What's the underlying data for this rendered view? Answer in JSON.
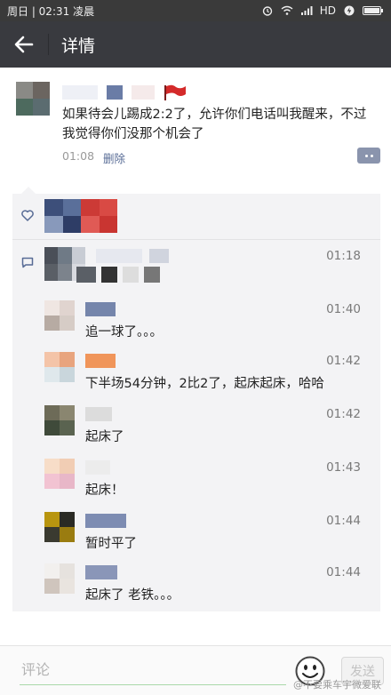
{
  "statusbar": {
    "left": "周日 | 02:31 凌晨",
    "network": "HD"
  },
  "header": {
    "title": "详情"
  },
  "post": {
    "text": "如果待会儿踢成2:2了，允许你们电话叫我醒来，不过我觉得你们没那个机会了",
    "time": "01:08",
    "delete_label": "删除"
  },
  "comments": [
    {
      "time": "01:18",
      "text": ""
    },
    {
      "time": "01:40",
      "text": "追一球了。。。"
    },
    {
      "time": "01:42",
      "text": "下半场54分钟，2比2了，起床起床，哈哈"
    },
    {
      "time": "01:42",
      "text": "起床了"
    },
    {
      "time": "01:43",
      "text": "起床！"
    },
    {
      "time": "01:44",
      "text": "暂时平了"
    },
    {
      "time": "01:44",
      "text": "起床了 老铁。。。"
    }
  ],
  "input": {
    "placeholder": "评论",
    "send_label": "发送"
  },
  "watermark": "@不要乘车宇微爱联",
  "icons": {
    "back": "back-arrow-icon",
    "like": "heart-icon",
    "comment": "comment-icon",
    "emoji": "smiley-icon",
    "more": "more-dots-icon"
  },
  "colors": {
    "titlebar": "#393a3f",
    "link": "#576b95",
    "feedback_bg": "#f3f3f5"
  }
}
